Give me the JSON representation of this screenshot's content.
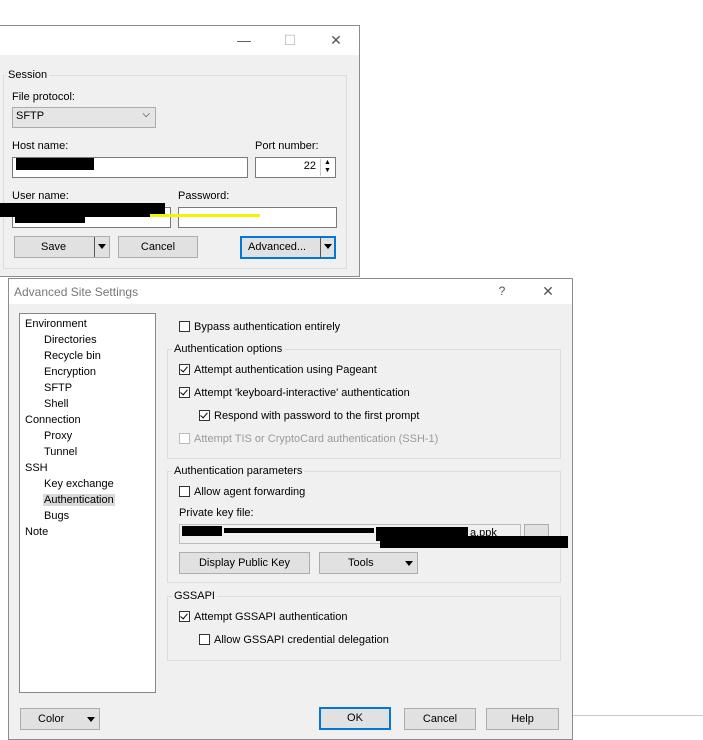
{
  "session_window": {
    "controls": {
      "minimize": "—",
      "maximize": "☐",
      "close": "✕"
    },
    "session_group": "Session",
    "file_protocol": {
      "label": "File protocol:",
      "value": "SFTP"
    },
    "host_name": {
      "label": "Host name:",
      "value": ""
    },
    "port_number": {
      "label": "Port number:",
      "value": "22"
    },
    "user_name": {
      "label": "User name:",
      "value": ""
    },
    "password": {
      "label": "Password:",
      "value": ""
    },
    "buttons": {
      "save": "Save",
      "cancel": "Cancel",
      "advanced": "Advanced..."
    }
  },
  "advanced_window": {
    "title": "Advanced Site Settings",
    "controls": {
      "help": "?",
      "close": "✕"
    },
    "tree": {
      "items": [
        {
          "label": "Environment",
          "level": 0
        },
        {
          "label": "Directories",
          "level": 1
        },
        {
          "label": "Recycle bin",
          "level": 1
        },
        {
          "label": "Encryption",
          "level": 1
        },
        {
          "label": "SFTP",
          "level": 1
        },
        {
          "label": "Shell",
          "level": 1
        },
        {
          "label": "Connection",
          "level": 0
        },
        {
          "label": "Proxy",
          "level": 1
        },
        {
          "label": "Tunnel",
          "level": 1
        },
        {
          "label": "SSH",
          "level": 0
        },
        {
          "label": "Key exchange",
          "level": 1
        },
        {
          "label": "Authentication",
          "level": 1,
          "selected": true
        },
        {
          "label": "Bugs",
          "level": 1
        },
        {
          "label": "Note",
          "level": 0
        }
      ]
    },
    "bypass": {
      "label": "Bypass authentication entirely",
      "checked": false
    },
    "auth_options": {
      "title": "Authentication options",
      "pageant": {
        "label": "Attempt authentication using Pageant",
        "checked": true
      },
      "keyboard_interactive": {
        "label": "Attempt 'keyboard-interactive' authentication",
        "checked": true
      },
      "respond_password": {
        "label": "Respond with password to the first prompt",
        "checked": true
      },
      "tis": {
        "label": "Attempt TIS or CryptoCard authentication (SSH-1)",
        "checked": false,
        "disabled": true
      }
    },
    "auth_params": {
      "title": "Authentication parameters",
      "agent_forwarding": {
        "label": "Allow agent forwarding",
        "checked": false
      },
      "private_key": {
        "label": "Private key file:",
        "value": "C:\\...a.ppk",
        "visible_suffix": "a.ppk"
      },
      "display_public_key": "Display Public Key",
      "tools": "Tools"
    },
    "gssapi": {
      "title": "GSSAPI",
      "attempt": {
        "label": "Attempt GSSAPI authentication",
        "checked": true
      },
      "delegation": {
        "label": "Allow GSSAPI credential delegation",
        "checked": false
      }
    },
    "footer": {
      "color": "Color",
      "ok": "OK",
      "cancel": "Cancel",
      "help": "Help"
    }
  }
}
